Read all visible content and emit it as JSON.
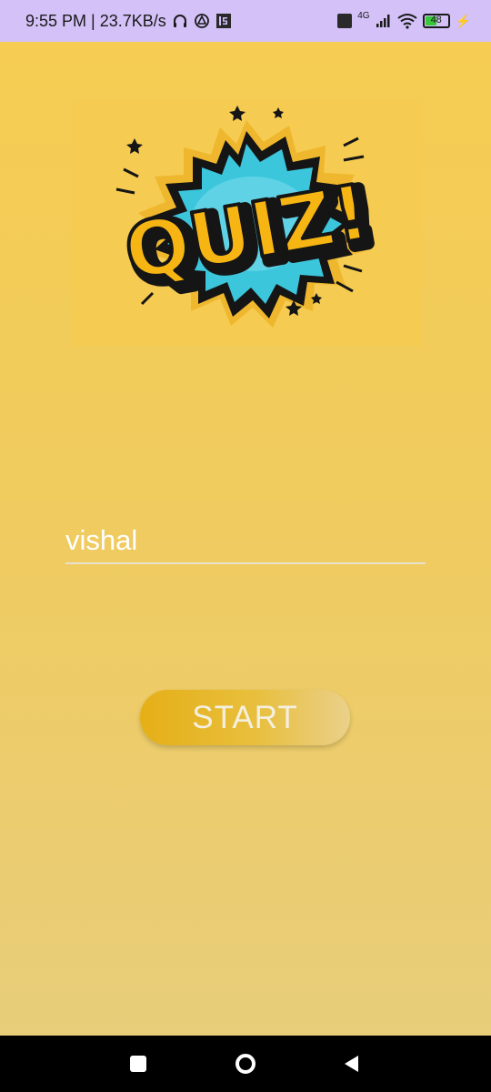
{
  "status_bar": {
    "time_speed": "9:55 PM | 23.7KB/s",
    "network_label": "4G",
    "volte_label": "Vo LTE",
    "battery_level": "48",
    "icons": [
      "headphones-icon",
      "drive-icon",
      "is-app-icon",
      "volte-icon",
      "signal-icon",
      "wifi-icon",
      "battery-icon",
      "charging-icon"
    ]
  },
  "logo": {
    "text": "QUIZ!"
  },
  "name_input": {
    "value": "vishal"
  },
  "start_button": {
    "label": "START"
  },
  "nav_bar": {
    "icons": [
      "recents-icon",
      "home-icon",
      "back-icon"
    ]
  },
  "colors": {
    "status_bar_bg": "#d3c1f7",
    "app_bg_top": "#f6cd52",
    "app_bg_bottom": "#e8cd7a",
    "button_start": "#e5af17",
    "button_end": "#ead08a",
    "quiz_yellow": "#f7b514",
    "burst_cyan": "#3cc6dc"
  }
}
